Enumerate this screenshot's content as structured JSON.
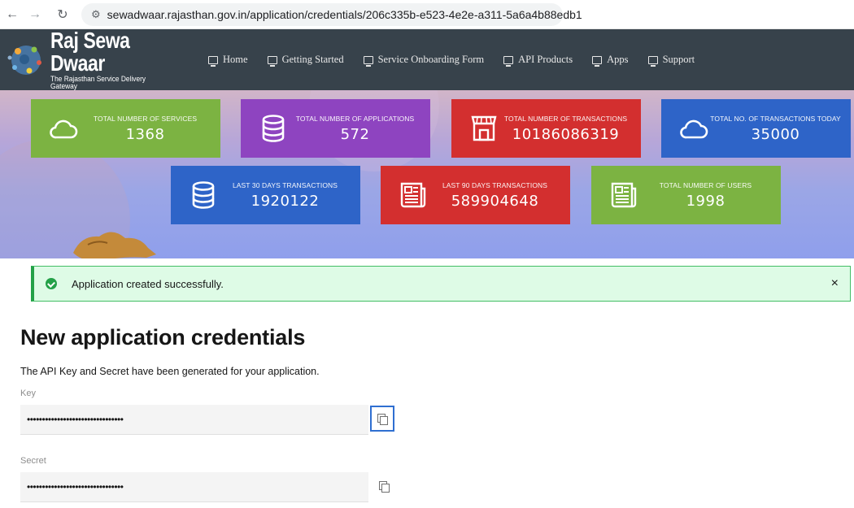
{
  "browser": {
    "url": "sewadwaar.rajasthan.gov.in/application/credentials/206c335b-e523-4e2e-a311-5a6a4b88edb1",
    "back_icon": "arrow-left-icon",
    "forward_icon": "arrow-right-icon",
    "reload_icon": "reload-icon",
    "site_info_icon": "tune-icon"
  },
  "header": {
    "title": "Raj Sewa Dwaar",
    "subtitle": "The Rajasthan Service Delivery Gateway",
    "nav": [
      {
        "label": "Home"
      },
      {
        "label": "Getting Started"
      },
      {
        "label": "Service Onboarding Form"
      },
      {
        "label": "API Products"
      },
      {
        "label": "Apps"
      },
      {
        "label": "Support"
      }
    ]
  },
  "stats": [
    {
      "label": "TOTAL NUMBER OF SERVICES",
      "value": "1368",
      "color": "#7cb342",
      "icon": "cloud-icon"
    },
    {
      "label": "TOTAL NUMBER OF APPLICATIONS",
      "value": "572",
      "color": "#8e44c0",
      "icon": "database-icon"
    },
    {
      "label": "TOTAL NUMBER OF TRANSACTIONS",
      "value": "10186086319",
      "color": "#d32f2f",
      "icon": "store-icon"
    },
    {
      "label": "TOTAL NO. OF TRANSACTIONS TODAY",
      "value": "35000",
      "color": "#2e64c8",
      "icon": "cloud-icon"
    },
    {
      "label": "LAST 30 DAYS TRANSACTIONS",
      "value": "1920122",
      "color": "#2e64c8",
      "icon": "database-icon"
    },
    {
      "label": "LAST 90 DAYS TRANSACTIONS",
      "value": "589904648",
      "color": "#d32f2f",
      "icon": "newspaper-icon"
    },
    {
      "label": "TOTAL NUMBER OF USERS",
      "value": "1998",
      "color": "#7cb342",
      "icon": "newspaper-icon"
    }
  ],
  "alert": {
    "message": "Application created successfully.",
    "close": "×",
    "icon": "checkmark-circle-icon"
  },
  "main": {
    "title": "New application credentials",
    "description": "The API Key and Secret have been generated for your application.",
    "key_label": "Key",
    "key_value": "••••••••••••••••••••••••••••••••",
    "secret_label": "Secret",
    "secret_value": "••••••••••••••••••••••••••••••••",
    "copy_icon": "copy-icon"
  }
}
